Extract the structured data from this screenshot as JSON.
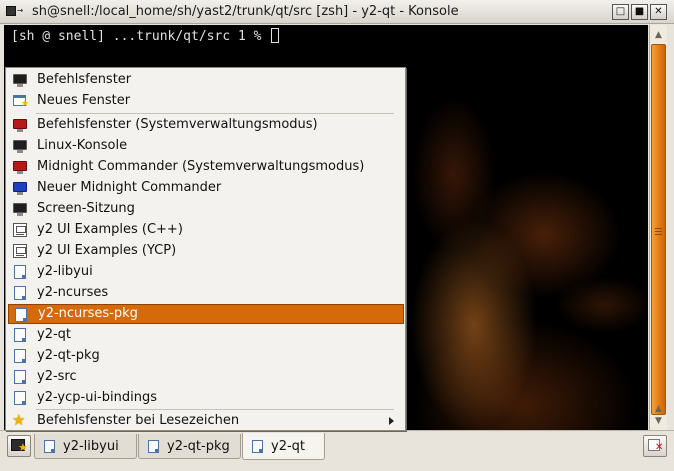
{
  "window": {
    "title": "sh@snell:/local_home/sh/yast2/trunk/qt/src  [zsh] - y2-qt - Konsole",
    "app_icon_arrow": "→",
    "buttons": {
      "minimize": "□",
      "maximize": "■",
      "close": "✕"
    }
  },
  "terminal": {
    "prompt": "[sh @ snell] ...trunk/qt/src 1 % "
  },
  "scrollbar": {
    "arrow_up": "▲",
    "arrow_up_lower": "▲",
    "arrow_down": "▼"
  },
  "menu": {
    "items": [
      {
        "label": "Befehlsfenster",
        "icon": "terminal-icon"
      },
      {
        "label": "Neues Fenster",
        "icon": "new-window-icon"
      },
      {
        "label": "Befehlsfenster (Systemverwaltungsmodus)",
        "icon": "root-terminal-icon"
      },
      {
        "label": "Linux-Konsole",
        "icon": "terminal-icon"
      },
      {
        "label": "Midnight Commander (Systemverwaltungsmodus)",
        "icon": "root-terminal-icon"
      },
      {
        "label": "Neuer Midnight Commander",
        "icon": "midnight-commander-icon"
      },
      {
        "label": "Screen-Sitzung",
        "icon": "terminal-icon"
      },
      {
        "label": "y2 UI Examples (C++)",
        "icon": "ycp-icon"
      },
      {
        "label": "y2 UI Examples (YCP)",
        "icon": "ycp-icon"
      },
      {
        "label": "y2-libyui",
        "icon": "document-icon"
      },
      {
        "label": "y2-ncurses",
        "icon": "document-icon"
      },
      {
        "label": "y2-ncurses-pkg",
        "icon": "document-icon",
        "highlighted": true
      },
      {
        "label": "y2-qt",
        "icon": "document-icon"
      },
      {
        "label": "y2-qt-pkg",
        "icon": "document-icon"
      },
      {
        "label": "y2-src",
        "icon": "document-icon"
      },
      {
        "label": "y2-ycp-ui-bindings",
        "icon": "document-icon"
      },
      {
        "label": "Befehlsfenster bei Lesezeichen",
        "icon": "bookmark-star-icon",
        "submenu": true
      }
    ],
    "highlight_color": "#d56a0b"
  },
  "tabs": [
    {
      "label": "y2-libyui",
      "active": false
    },
    {
      "label": "y2-qt-pkg",
      "active": false
    },
    {
      "label": "y2-qt",
      "active": true
    }
  ],
  "colors": {
    "accent": "#e2780e",
    "terminal_bg": "#000000",
    "menu_bg": "#f4f2ee"
  }
}
